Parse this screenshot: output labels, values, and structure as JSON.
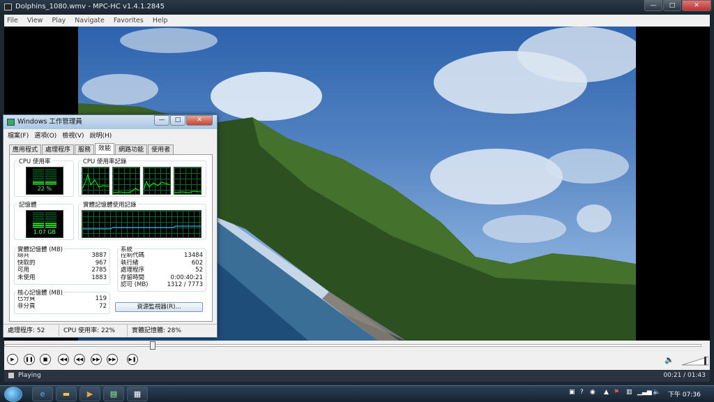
{
  "player": {
    "title": "Dolphins_1080.wmv - MPC-HC v1.4.1.2845",
    "menu": [
      "File",
      "View",
      "Play",
      "Navigate",
      "Favorites",
      "Help"
    ],
    "status": "Playing",
    "time": "00:21 / 01:43",
    "progress": 0.21,
    "volume": 0.9
  },
  "taskmgr": {
    "title": "Windows 工作管理員",
    "menu": [
      "檔案(F)",
      "選項(O)",
      "檢視(V)",
      "說明(H)"
    ],
    "tabs": [
      "應用程式",
      "處理程序",
      "服務",
      "效能",
      "網路功能",
      "使用者"
    ],
    "active_tab": 3,
    "cpu_label": "CPU 使用率",
    "cpu_value": "22 %",
    "cpu_percent": 22,
    "cpu_history_label": "CPU 使用率記錄",
    "mem_label": "記憶體",
    "mem_value": "1.07 GB",
    "mem_percent": 28,
    "mem_history_label": "實體記憶體使用記錄",
    "physical": {
      "label": "實體記憶體 (MB)",
      "rows": [
        {
          "k": "總共",
          "v": "3887"
        },
        {
          "k": "快取的",
          "v": "967"
        },
        {
          "k": "可用",
          "v": "2785"
        },
        {
          "k": "未使用",
          "v": "1883"
        }
      ]
    },
    "kernel": {
      "label": "核心記憶體 (MB)",
      "rows": [
        {
          "k": "已分頁",
          "v": "119"
        },
        {
          "k": "非分頁",
          "v": "72"
        }
      ]
    },
    "system": {
      "label": "系統",
      "rows": [
        {
          "k": "控制代碼",
          "v": "13484"
        },
        {
          "k": "執行緒",
          "v": "602"
        },
        {
          "k": "處理程序",
          "v": "52"
        },
        {
          "k": "存留時間",
          "v": "0:00:40:21"
        },
        {
          "k": "認可 (MB)",
          "v": "1312 / 7773"
        }
      ]
    },
    "resource_button": "資源監視器(R)...",
    "statusbar": {
      "processes": "處理程序: 52",
      "cpu": "CPU 使用率: 22%",
      "memory": "實體記憶體: 28%"
    }
  },
  "taskbar": {
    "clock": "下午 07:36"
  }
}
